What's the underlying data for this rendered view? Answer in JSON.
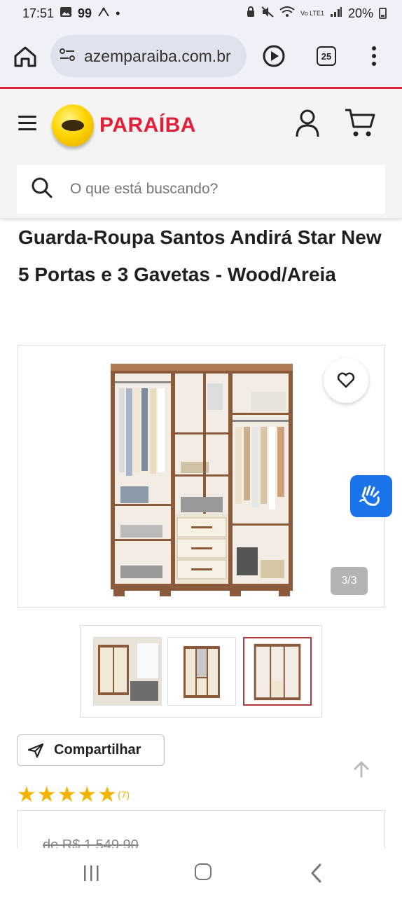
{
  "status_bar": {
    "time": "17:51",
    "notif_count": "99",
    "battery": "20%",
    "network": "Vo LTE1"
  },
  "browser": {
    "url": "azemparaiba.com.br",
    "tab_count": "25"
  },
  "site": {
    "logo_text": "PARAÍBA",
    "search_placeholder": "O que está buscando?"
  },
  "product": {
    "title": "Guarda-Roupa Santos Andirá Star New 5 Portas e 3 Gavetas - Wood/Areia",
    "image_counter": "3/3",
    "thumbnails": [
      {
        "label": "thumbnail-1",
        "active": false
      },
      {
        "label": "thumbnail-2",
        "active": false
      },
      {
        "label": "thumbnail-3",
        "active": true
      }
    ],
    "share_label": "Compartilhar",
    "rating": 5,
    "review_count": "(7)",
    "old_price": "de R$ 1.549,90"
  },
  "colors": {
    "brand_red": "#e3203a",
    "star": "#f5b301",
    "accessibility_blue": "#1a73e8"
  }
}
